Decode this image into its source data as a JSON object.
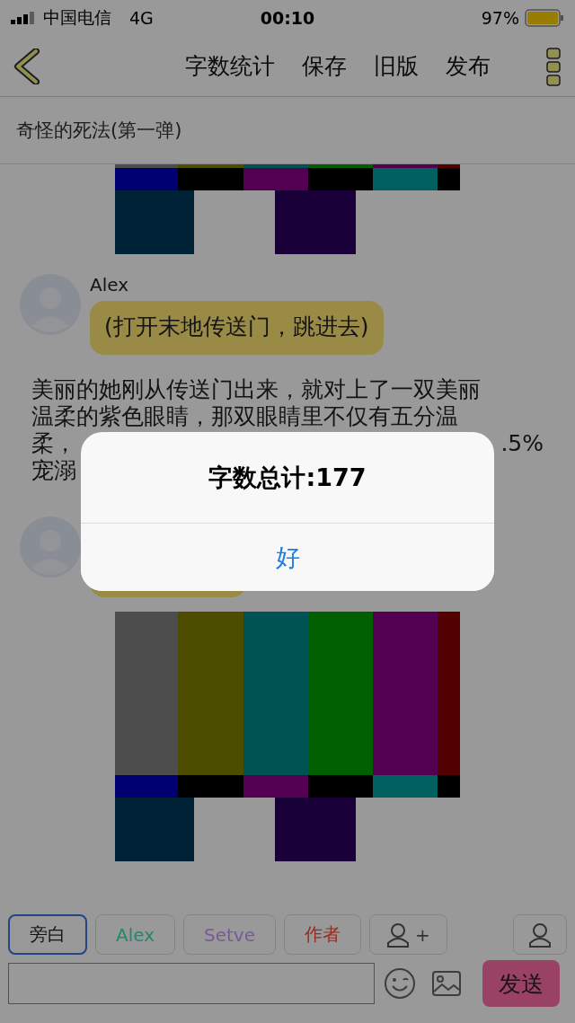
{
  "status_bar": {
    "carrier": "中国电信",
    "network": "4G",
    "time": "00:10",
    "battery": "97%"
  },
  "nav": {
    "actions": [
      "字数统计",
      "保存",
      "旧版",
      "发布"
    ]
  },
  "story_title": "奇怪的死法(第一弹)",
  "messages": [
    {
      "kind": "picture"
    },
    {
      "kind": "bubble",
      "name": "Alex",
      "text": "(打开末地传送门，跳进去)"
    },
    {
      "kind": "narration",
      "lines": [
        [
          "美丽的她刚从传送门出来，就对上了一双美丽"
        ],
        [
          "温柔的紫色眼睛，那双眼睛里不仅有五分温"
        ],
        [
          "柔，",
          ".5%"
        ],
        [
          "宠溺"
        ]
      ]
    },
    {
      "kind": "bubble"
    },
    {
      "kind": "picture"
    }
  ],
  "roles": [
    {
      "kind": "role",
      "label": "旁白",
      "color": "#141414",
      "selected": true
    },
    {
      "kind": "role",
      "label": "Alex",
      "color": "#1f8a6e",
      "selected": false
    },
    {
      "kind": "role",
      "label": "Setve",
      "color": "#7a5a96",
      "selected": false
    },
    {
      "kind": "role",
      "label": "作者",
      "color": "#992a20",
      "selected": false
    },
    {
      "kind": "add",
      "label": "+",
      "selected": false
    }
  ],
  "composer": {
    "send": "发送"
  },
  "alert": {
    "title": "字数总计:177",
    "button": "好"
  }
}
